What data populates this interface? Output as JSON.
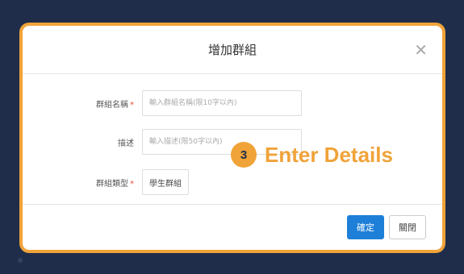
{
  "dialog": {
    "title": "增加群組",
    "close_icon": "close-icon",
    "fields": [
      {
        "label": "群組名稱",
        "required_mark": "*",
        "placeholder": "輸入群組名稱(限10字以內)"
      },
      {
        "label": "描述",
        "placeholder": "輸入描述(限50字以內)"
      },
      {
        "label": "群組類型",
        "required_mark": "*",
        "value": "學生群組"
      }
    ],
    "buttons": {
      "confirm": "確定",
      "close": "關閉"
    }
  },
  "callout": {
    "step": "3",
    "text": "Enter Details"
  },
  "colors": {
    "accent": "#f0a339",
    "primary": "#1e7fd8",
    "background": "#1f2d4a",
    "required": "#e74c3c"
  }
}
